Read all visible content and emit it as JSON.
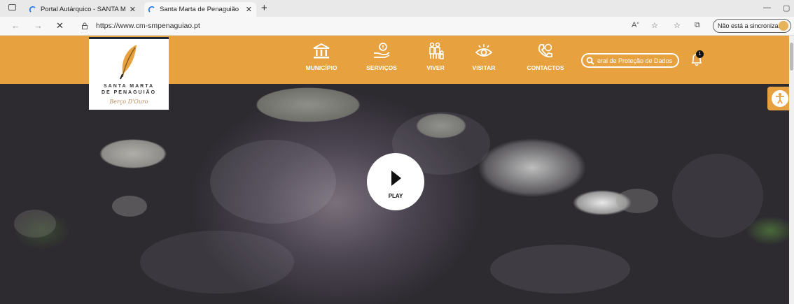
{
  "browser": {
    "tabs": [
      {
        "label": "Portal Autárquico - SANTA MAR",
        "active": false
      },
      {
        "label": "Santa Marta de Penaguião",
        "active": true
      }
    ],
    "address": "https://www.cm-smpenaguiao.pt",
    "sync_label": "Não está a sincronizar",
    "icons": [
      "back-icon",
      "forward-icon",
      "stop-icon",
      "lock-icon",
      "read-aloud-icon",
      "favorites-add-icon",
      "favorites-icon",
      "collections-icon"
    ]
  },
  "site": {
    "logo": {
      "line1": "SANTA MARTA",
      "line2": "DE PENAGUIÃO",
      "tagline": "Berço D'Ouro"
    },
    "menu": [
      {
        "label": "MUNICÍPIO",
        "icon": "building-icon"
      },
      {
        "label": "SERVIÇOS",
        "icon": "hand-service-icon"
      },
      {
        "label": "VIVER",
        "icon": "family-icon"
      },
      {
        "label": "VISITAR",
        "icon": "eye-icon"
      },
      {
        "label": "CONTACTOS",
        "icon": "phone-icon"
      }
    ],
    "search_value": "eral de Proteção de Dados",
    "notification_count": "1",
    "play_label": "PLAY",
    "colors": {
      "brand": "#e7a23f",
      "navy": "#1e2a3a"
    }
  }
}
